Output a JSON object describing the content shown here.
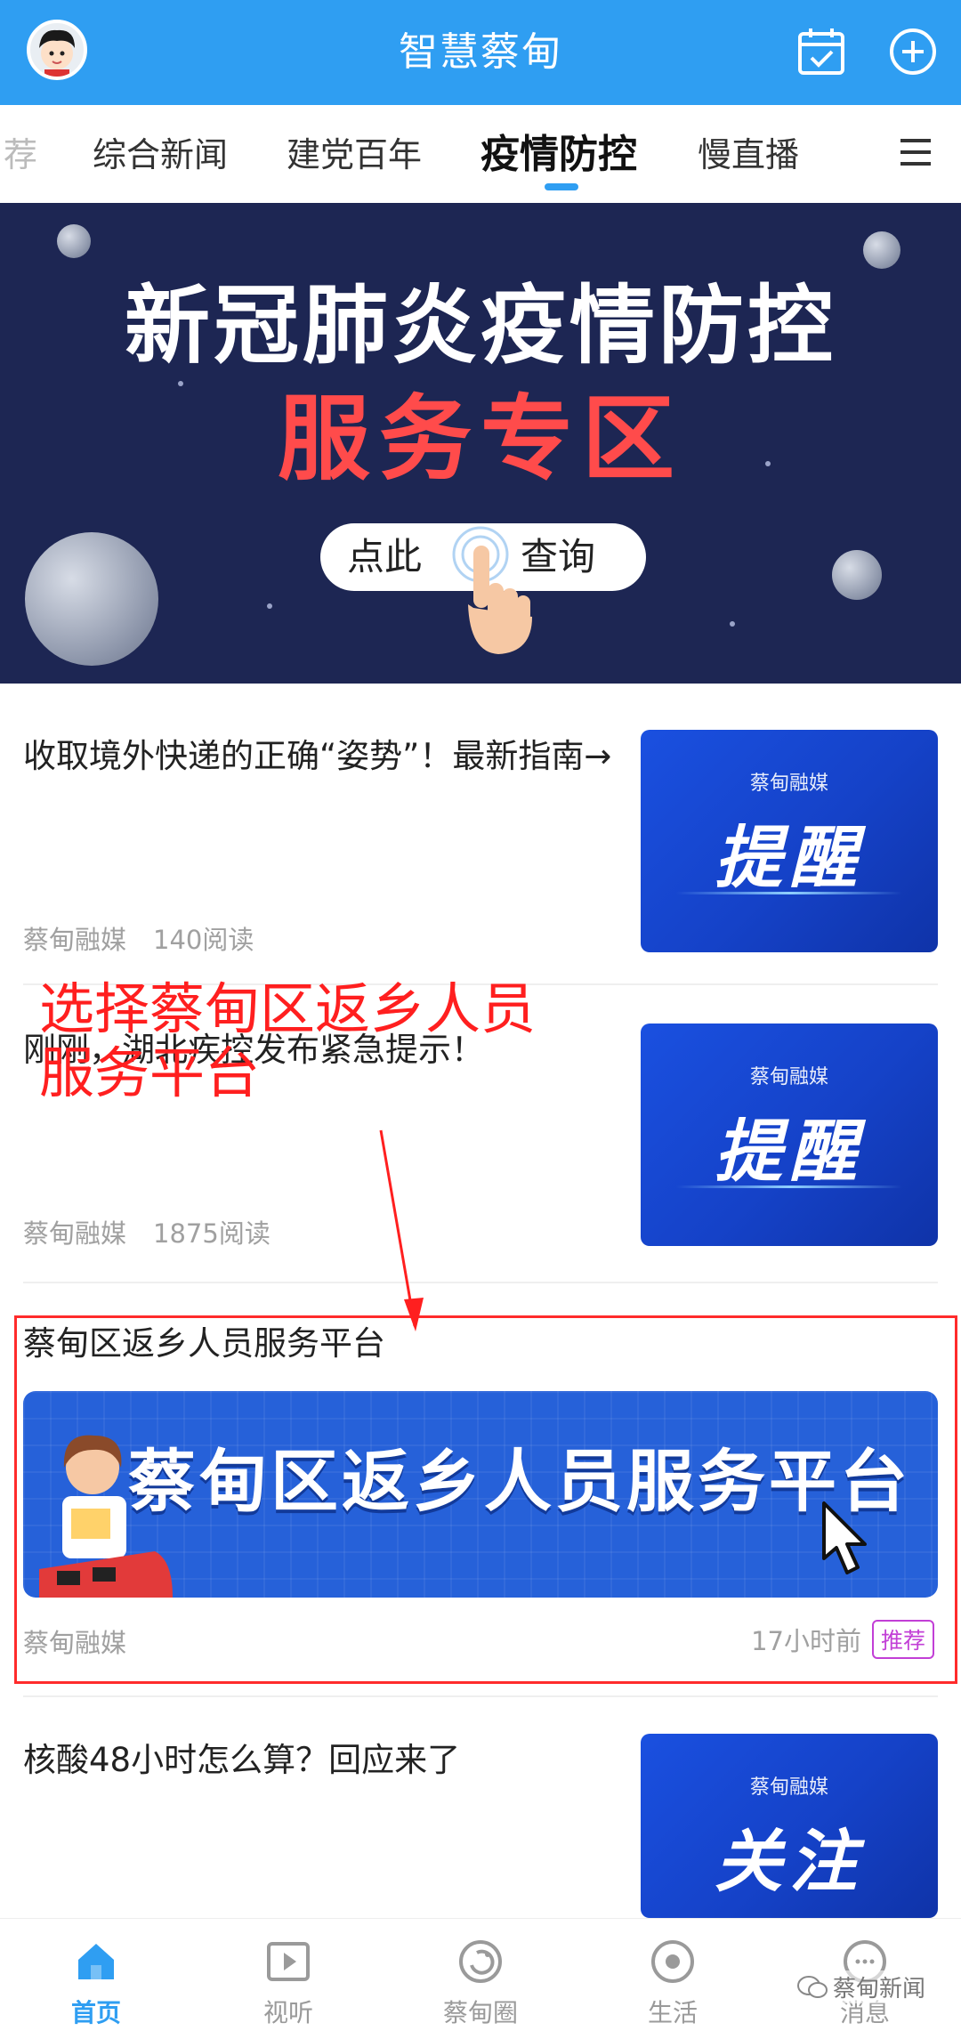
{
  "header": {
    "title": "智慧蔡甸",
    "calendar_icon": "calendar-check-icon",
    "add_icon": "plus-circle-icon",
    "bg_color": "#2f9ef2"
  },
  "tabs": [
    {
      "label": "荐",
      "state": "partial"
    },
    {
      "label": "综合新闻",
      "state": "normal"
    },
    {
      "label": "建党百年",
      "state": "normal"
    },
    {
      "label": "疫情防控",
      "state": "active"
    },
    {
      "label": "慢直播",
      "state": "normal"
    }
  ],
  "tabs_menu_icon": "hamburger-menu-icon",
  "banner": {
    "line1": "新冠肺炎疫情防控",
    "line2": "服务专区",
    "button_left": "点此",
    "button_right": "查询"
  },
  "news": [
    {
      "title": "收取境外快递的正确“姿势”！最新指南→",
      "source": "蔡甸融媒",
      "reads": "140阅读",
      "thumb_brand": "蔡甸融媒",
      "thumb_text": "提醒"
    },
    {
      "title": "刚刚，湖北疾控发布紧急提示！",
      "source": "蔡甸融媒",
      "reads": "1875阅读",
      "thumb_brand": "蔡甸融媒",
      "thumb_text": "提醒"
    },
    {
      "title": "蔡甸区返乡人员服务平台",
      "source": "蔡甸融媒",
      "banner_text": "蔡甸区返乡人员服务平台",
      "time": "17小时前",
      "badge": "推荐"
    },
    {
      "title": "核酸48小时怎么算？回应来了",
      "thumb_brand": "蔡甸融媒",
      "thumb_text": "关注"
    }
  ],
  "annotation": {
    "text": "选择蔡甸区返乡人员\n服务平台",
    "color": "#ff1f1f"
  },
  "bottom_nav": [
    {
      "label": "首页",
      "icon": "home-icon",
      "active": true
    },
    {
      "label": "视听",
      "icon": "play-video-icon",
      "active": false
    },
    {
      "label": "蔡甸圈",
      "icon": "circle-community-icon",
      "active": false
    },
    {
      "label": "生活",
      "icon": "life-icon",
      "active": false
    },
    {
      "label": "消息",
      "icon": "message-icon",
      "active": false
    }
  ],
  "watermark": "蔡甸新闻"
}
